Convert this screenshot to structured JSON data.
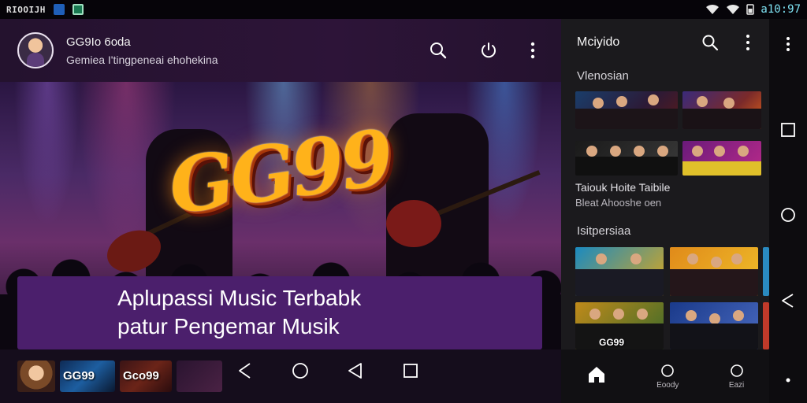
{
  "status_bar": {
    "app_label": "RIOOIJH",
    "time": "a10:97"
  },
  "header": {
    "title": "GG9Io 6oda",
    "subtitle": "Gemiea I'tingpeneai ehohekina"
  },
  "hero": {
    "logo_text": "GG99",
    "banner_line1": "Aplupassi Music Terbabk",
    "banner_line2": "patur Pengemar Musik"
  },
  "bottom_strip": {
    "thumb_labels": [
      "",
      "GG99",
      "Gco99",
      ""
    ]
  },
  "side_panel": {
    "title": "Mciyido",
    "section1_title": "Vlenosian",
    "trending_title": "Taiouk Hoite Taibile",
    "trending_sub": "Bleat Ahooshe oen",
    "section2_title": "Isitpersiaa",
    "tile_badge": "GG99",
    "nav": [
      {
        "label": ""
      },
      {
        "label": "Eoody"
      },
      {
        "label": "Eazi"
      }
    ]
  },
  "colors": {
    "accent_purple": "#4b1f6c",
    "logo_gold": "#ffb21a",
    "time_cyan": "#7fe3f4"
  },
  "icons": [
    "search-icon",
    "power-icon",
    "more-vert-icon",
    "home-icon",
    "circle-icon",
    "back-icon",
    "square-icon"
  ]
}
